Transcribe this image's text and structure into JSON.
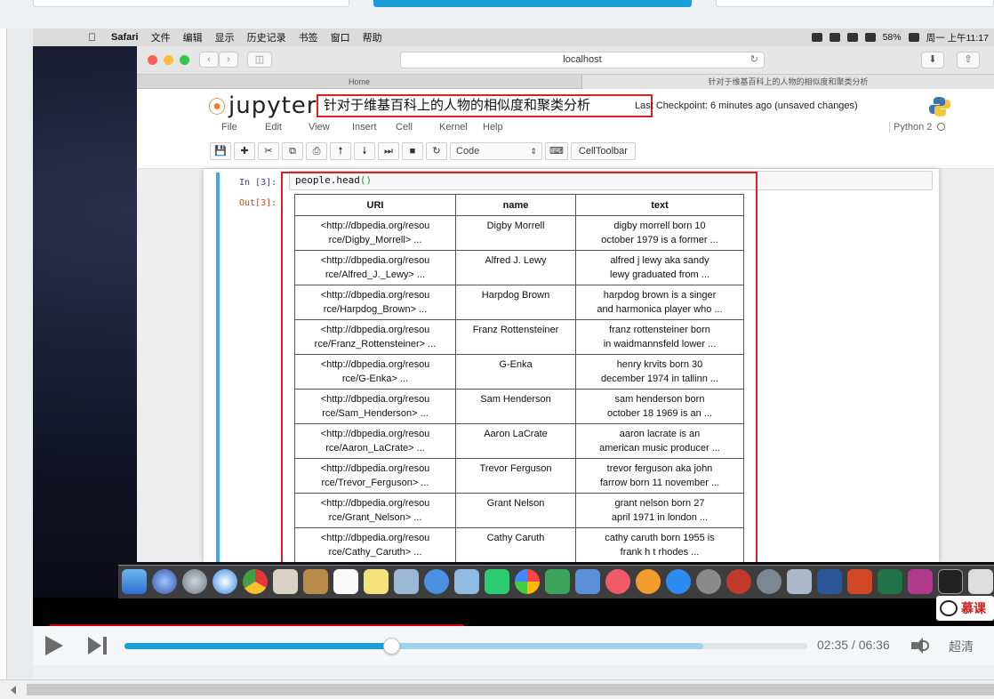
{
  "mac_menubar": {
    "app": "Safari",
    "items": [
      "文件",
      "编辑",
      "显示",
      "历史记录",
      "书签",
      "窗口",
      "帮助"
    ],
    "battery": "58%",
    "clock": "周一 上午11:17"
  },
  "browser": {
    "url": "localhost",
    "tabs": [
      "Home",
      "针对于维基百科上的人物的相似度和聚类分析"
    ]
  },
  "jupyter": {
    "logo": "jupyter",
    "notebook_title": "针对于维基百科上的人物的相似度和聚类分析",
    "checkpoint": "Last Checkpoint: 6 minutes ago (unsaved changes)",
    "menu": [
      "File",
      "Edit",
      "View",
      "Insert",
      "Cell",
      "Kernel",
      "Help"
    ],
    "kernel": "Python 2",
    "toolbar": {
      "cell_type": "Code",
      "celltoolbar": "CellToolbar"
    }
  },
  "cell": {
    "in_prompt": "In [3]:",
    "code": "people.head",
    "code_parens": "()",
    "out_prompt": "Out[3]:"
  },
  "dataframe": {
    "columns": [
      "URI",
      "name",
      "text"
    ],
    "rows": [
      {
        "uri1": "<http://dbpedia.org/resou",
        "uri2": "rce/Digby_Morrell> ...",
        "name": "Digby Morrell",
        "text1": "digby morrell born 10",
        "text2": "october 1979 is a former ..."
      },
      {
        "uri1": "<http://dbpedia.org/resou",
        "uri2": "rce/Alfred_J._Lewy> ...",
        "name": "Alfred J. Lewy",
        "text1": "alfred j lewy aka sandy",
        "text2": "lewy graduated from ..."
      },
      {
        "uri1": "<http://dbpedia.org/resou",
        "uri2": "rce/Harpdog_Brown> ...",
        "name": "Harpdog Brown",
        "text1": "harpdog brown is a singer",
        "text2": "and harmonica player who ..."
      },
      {
        "uri1": "<http://dbpedia.org/resou",
        "uri2": "rce/Franz_Rottensteiner> ...",
        "name": "Franz Rottensteiner",
        "text1": "franz rottensteiner born",
        "text2": "in waidmannsfeld lower ..."
      },
      {
        "uri1": "<http://dbpedia.org/resou",
        "uri2": "rce/G-Enka> ...",
        "name": "G-Enka",
        "text1": "henry krvits born 30",
        "text2": "december 1974 in tallinn ..."
      },
      {
        "uri1": "<http://dbpedia.org/resou",
        "uri2": "rce/Sam_Henderson> ...",
        "name": "Sam Henderson",
        "text1": "sam henderson born",
        "text2": "october 18 1969 is an ..."
      },
      {
        "uri1": "<http://dbpedia.org/resou",
        "uri2": "rce/Aaron_LaCrate> ...",
        "name": "Aaron LaCrate",
        "text1": "aaron lacrate is an",
        "text2": "american music producer ..."
      },
      {
        "uri1": "<http://dbpedia.org/resou",
        "uri2": "rce/Trevor_Ferguson> ...",
        "name": "Trevor Ferguson",
        "text1": "trevor ferguson aka john",
        "text2": "farrow born 11 november ..."
      },
      {
        "uri1": "<http://dbpedia.org/resou",
        "uri2": "rce/Grant_Nelson> ...",
        "name": "Grant Nelson",
        "text1": "grant nelson born 27",
        "text2": "april 1971 in london ..."
      },
      {
        "uri1": "<http://dbpedia.org/resou",
        "uri2": "rce/Cathy_Caruth> ...",
        "name": "Cathy Caruth",
        "text1": "cathy caruth born 1955 is",
        "text2": "frank h t rhodes ..."
      }
    ]
  },
  "watermark": "慕课",
  "player": {
    "current_time": "02:35",
    "separator": "/",
    "duration": "06:36",
    "quality": "超清",
    "progress_fraction": 0.391,
    "buffered_fraction": 0.848
  },
  "colors": {
    "accent": "#1a9ed8",
    "highlight_box": "#e02020",
    "jupyter_orange": "#f37726"
  }
}
